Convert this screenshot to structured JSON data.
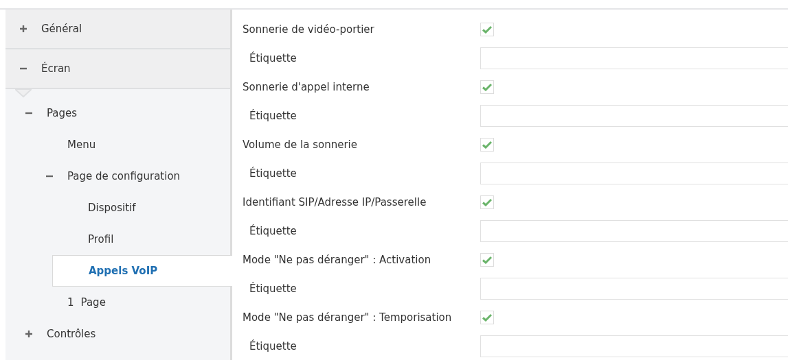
{
  "sidebar": {
    "items": [
      {
        "label": "Général",
        "expanded": false,
        "selected": false
      },
      {
        "label": "Écran",
        "expanded": true,
        "selected": false,
        "children": [
          {
            "label": "Pages",
            "expanded": true,
            "selected": false,
            "children": [
              {
                "label": "Menu",
                "selected": false
              },
              {
                "label": "Page de configuration",
                "expanded": true,
                "selected": false,
                "children": [
                  {
                    "label": "Dispositif",
                    "selected": false
                  },
                  {
                    "label": "Profil",
                    "selected": false
                  },
                  {
                    "label": "Appels VoIP",
                    "selected": true
                  }
                ]
              },
              {
                "prefix": "1",
                "label": "Page",
                "selected": false
              }
            ]
          },
          {
            "label": "Contrôles",
            "expanded": false,
            "selected": false
          }
        ]
      }
    ]
  },
  "settings": [
    {
      "kind": "checkbox",
      "label": "Sonnerie de vidéo-portier",
      "checked": true
    },
    {
      "kind": "text",
      "label": "Étiquette"
    },
    {
      "kind": "checkbox",
      "label": "Sonnerie d'appel interne",
      "checked": true
    },
    {
      "kind": "text",
      "label": "Étiquette"
    },
    {
      "kind": "checkbox",
      "label": "Volume de la sonnerie",
      "checked": true
    },
    {
      "kind": "text",
      "label": "Étiquette"
    },
    {
      "kind": "checkbox",
      "label": "Identifiant SIP/Adresse IP/Passerelle",
      "checked": true
    },
    {
      "kind": "text",
      "label": "Étiquette"
    },
    {
      "kind": "checkbox",
      "label": "Mode \"Ne pas déranger\" : Activation",
      "checked": true
    },
    {
      "kind": "text",
      "label": "Étiquette"
    },
    {
      "kind": "checkbox",
      "label": "Mode \"Ne pas déranger\" : Temporisation",
      "checked": true
    },
    {
      "kind": "text",
      "label": "Étiquette"
    }
  ]
}
